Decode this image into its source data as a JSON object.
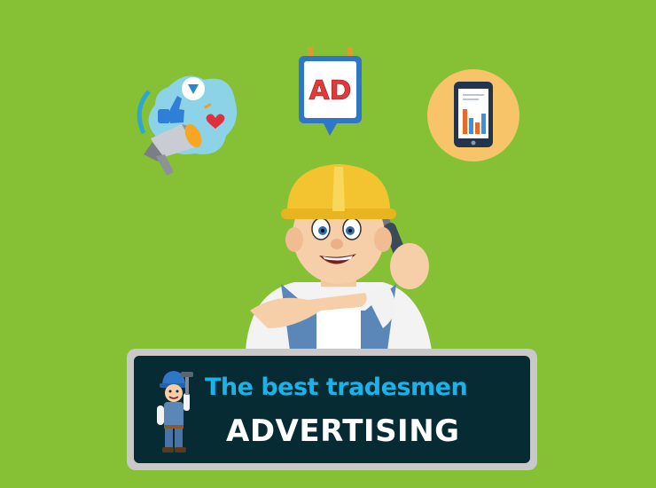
{
  "banner": {
    "headline": "The best tradesmen",
    "subline": "ADVERTISING"
  },
  "ad_board": {
    "text": "AD"
  },
  "icons": [
    "megaphone-social-icon",
    "ad-billboard-icon",
    "tablet-chart-icon",
    "tradesman-mascot",
    "tradesman-mini-mascot"
  ],
  "colors": {
    "background": "#86c035",
    "banner_frame": "#c9c9c9",
    "banner_fill": "#062b32",
    "headline": "#19b3ea",
    "subline": "#ffffff",
    "helmet": "#f4c430",
    "overalls": "#5b87b8",
    "phone_circle": "#f7c46a"
  }
}
